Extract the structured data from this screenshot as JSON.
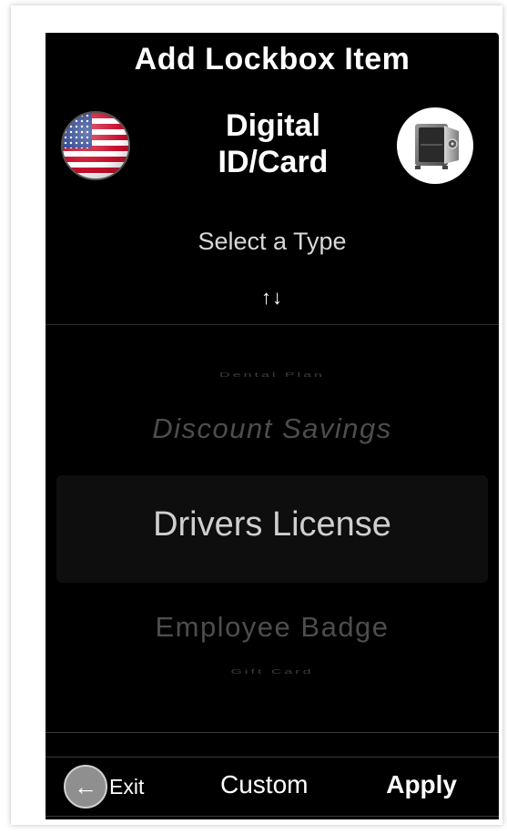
{
  "header": {
    "title": "Add Lockbox Item",
    "item_type": "Digital ID/Card"
  },
  "icons": {
    "flag": "us-flag-icon",
    "vault": "vault-safe-icon",
    "sort": "sort-arrows-icon",
    "exit": "back-arrow-icon"
  },
  "select": {
    "label": "Select a Type",
    "sort_glyph": "↑↓"
  },
  "picker": {
    "options": [
      "Dental Plan",
      "Discount Savings",
      "Drivers License",
      "Employee Badge",
      "Gift Card"
    ],
    "selected": "Drivers License"
  },
  "toolbar": {
    "exit_label": "Exit",
    "custom_label": "Custom",
    "apply_label": "Apply"
  },
  "colors": {
    "background": "#000000",
    "text": "#ffffff",
    "muted_text": "#4d4d4d",
    "exit_circle": "#8f8f8f"
  }
}
